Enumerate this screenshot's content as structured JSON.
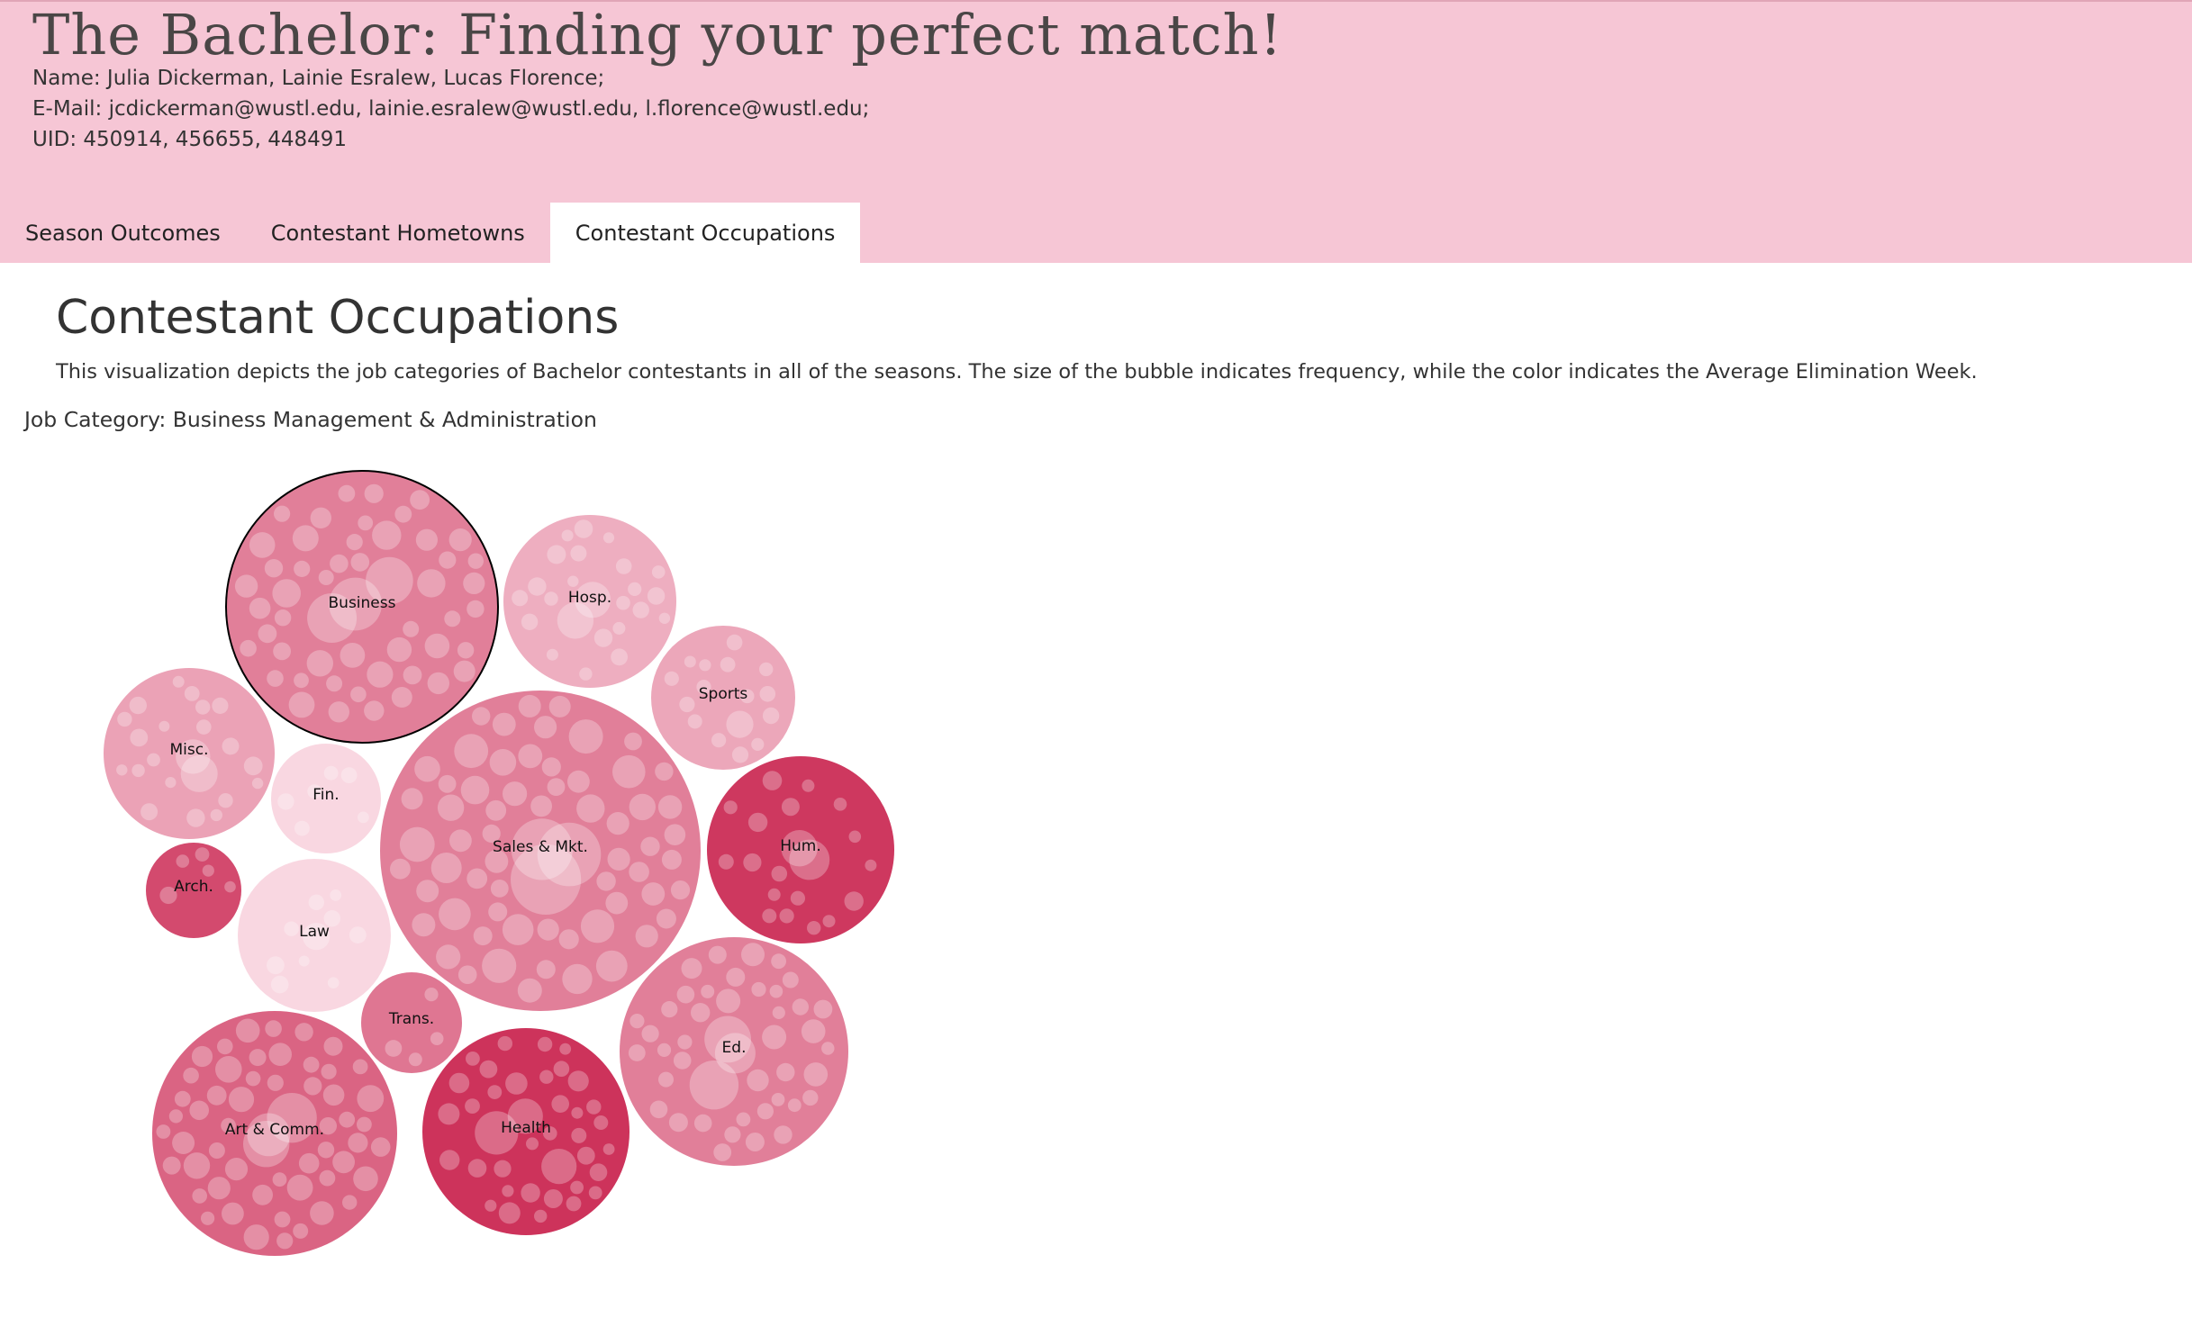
{
  "header": {
    "title": "The Bachelor: Finding your perfect match!",
    "names": "Name: Julia Dickerman, Lainie Esralew, Lucas Florence;",
    "emails": "E-Mail: jcdickerman@wustl.edu, lainie.esralew@wustl.edu, l.florence@wustl.edu;",
    "uids": "UID: 450914, 456655, 448491"
  },
  "tabs": [
    {
      "label": "Season Outcomes",
      "active": false
    },
    {
      "label": "Contestant Hometowns",
      "active": false
    },
    {
      "label": "Contestant Occupations",
      "active": true
    }
  ],
  "main": {
    "heading": "Contestant Occupations",
    "description": "This visualization depicts the job categories of Bachelor contestants in all of the seasons. The size of the bubble indicates frequency, while the color indicates the Average Elimination Week.",
    "job_category_text": "Job Category: Business Management & Administration"
  },
  "colors": {
    "header_bg": "#f6c6d5",
    "color_scale_light": "#fbe0e8",
    "color_scale_dark": "#cc2f58"
  },
  "chart_data": {
    "type": "bubble",
    "size_encoding": "frequency",
    "color_encoding": "Average Elimination Week",
    "highlighted": "Business",
    "bubbles": [
      {
        "label": "Business",
        "shade": 0.55,
        "count": 52
      },
      {
        "label": "Hosp.",
        "shade": 0.28,
        "count": 24
      },
      {
        "label": "Sports",
        "shade": 0.32,
        "count": 16
      },
      {
        "label": "Misc.",
        "shade": 0.35,
        "count": 22
      },
      {
        "label": "Fin.",
        "shade": 0.05,
        "count": 6
      },
      {
        "label": "Sales & Mkt.",
        "shade": 0.55,
        "count": 102
      },
      {
        "label": "Hum.",
        "shade": 0.95,
        "count": 20
      },
      {
        "label": "Arch.",
        "shade": 0.85,
        "count": 5
      },
      {
        "label": "Law",
        "shade": 0.05,
        "count": 10
      },
      {
        "label": "Trans.",
        "shade": 0.6,
        "count": 4
      },
      {
        "label": "Ed.",
        "shade": 0.55,
        "count": 44
      },
      {
        "label": "Art & Comm.",
        "shade": 0.7,
        "count": 56
      },
      {
        "label": "Health",
        "shade": 0.98,
        "count": 38
      }
    ]
  }
}
